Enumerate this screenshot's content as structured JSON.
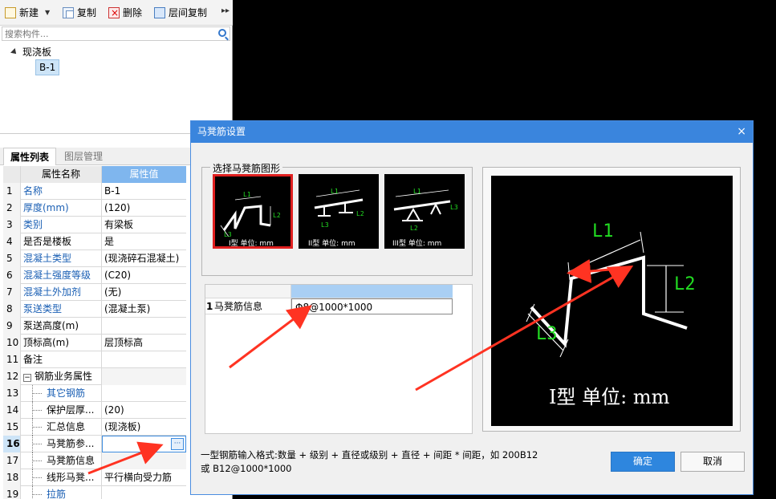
{
  "toolbar": {
    "new_label": "新建",
    "copy_label": "复制",
    "delete_label": "删除",
    "floor_copy_label": "层间复制"
  },
  "search": {
    "placeholder": "搜索构件..."
  },
  "tree": {
    "root_label": "现浇板",
    "child_label": "B-1"
  },
  "tabs": {
    "properties": "属性列表",
    "layers": "图层管理"
  },
  "grid": {
    "head_name": "属性名称",
    "head_value": "属性值",
    "rows": [
      {
        "num": "1",
        "name": "名称",
        "value": "B-1"
      },
      {
        "num": "2",
        "name": "厚度(mm)",
        "value": "(120)"
      },
      {
        "num": "3",
        "name": "类别",
        "value": "有梁板"
      },
      {
        "num": "4",
        "name": "是否是楼板",
        "value": "是"
      },
      {
        "num": "5",
        "name": "混凝土类型",
        "value": "(现浇碎石混凝土)"
      },
      {
        "num": "6",
        "name": "混凝土强度等级",
        "value": "(C20)"
      },
      {
        "num": "7",
        "name": "混凝土外加剂",
        "value": "(无)"
      },
      {
        "num": "8",
        "name": "泵送类型",
        "value": "(混凝土泵)"
      },
      {
        "num": "9",
        "name": "泵送高度(m)",
        "value": ""
      },
      {
        "num": "10",
        "name": "顶标高(m)",
        "value": "层顶标高"
      },
      {
        "num": "11",
        "name": "备注",
        "value": ""
      },
      {
        "num": "12",
        "name": "钢筋业务属性",
        "value": ""
      },
      {
        "num": "13",
        "name": "其它钢筋",
        "value": ""
      },
      {
        "num": "14",
        "name": "保护层厚...",
        "value": "(20)"
      },
      {
        "num": "15",
        "name": "汇总信息",
        "value": "(现浇板)"
      },
      {
        "num": "16",
        "name": "马凳筋参...",
        "value": ""
      },
      {
        "num": "17",
        "name": "马凳筋信息",
        "value": ""
      },
      {
        "num": "18",
        "name": "线形马凳...",
        "value": "平行横向受力筋"
      },
      {
        "num": "19",
        "name": "拉筋",
        "value": ""
      }
    ]
  },
  "dialog": {
    "title": "马凳筋设置",
    "close_glyph": "×",
    "group_label": "选择马凳筋图形",
    "shapes": [
      {
        "caption": "I型 单位: mm"
      },
      {
        "caption": "II型 单位: mm"
      },
      {
        "caption": "III型 单位: mm"
      }
    ],
    "labels": {
      "l1": "L1",
      "l2": "L2",
      "l3": "L3"
    },
    "table": {
      "row_num": "1",
      "row_key": "马凳筋信息",
      "row_value": "Φ8@1000*1000"
    },
    "preview_caption": "I型 单位: mm",
    "hint_line1": "一型钢筋输入格式:数量 + 级别 + 直径或级别 + 直径 + 间距 * 间距，如 200B12",
    "hint_line2": "或 B12@1000*1000",
    "ok_label": "确定",
    "cancel_label": "取消"
  },
  "colors": {
    "accent": "#3a85dd",
    "selected_border": "#e02020",
    "arrow": "#ff3322",
    "dim_green": "#22dd22"
  }
}
